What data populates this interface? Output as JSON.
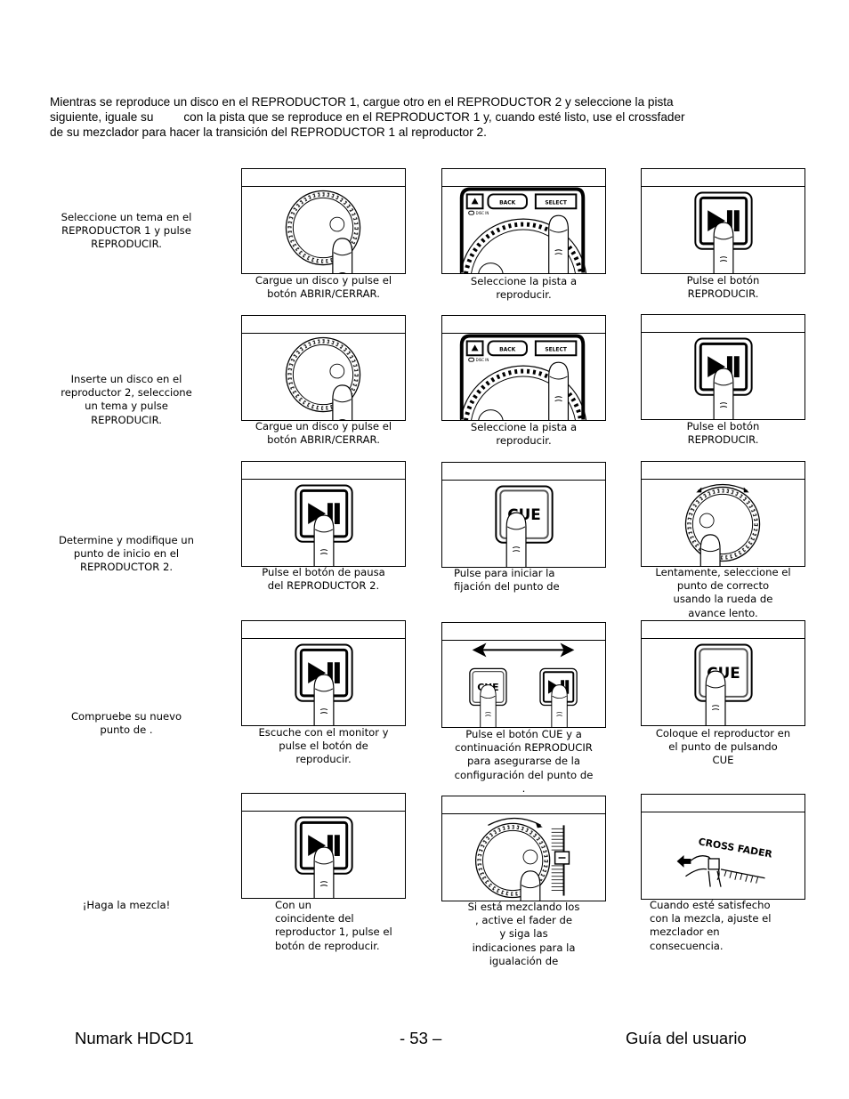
{
  "intro": {
    "line1": "Mientras se reproduce un disco en el REPRODUCTOR 1, cargue otro en el REPRODUCTOR 2 y seleccione la pista",
    "line2": "siguiente, iguale su         con la pista que se reproduce en el REPRODUCTOR 1 y, cuando esté listo, use el crossfader",
    "line3": "de su mezclador para hacer la transición del REPRODUCTOR 1 al reproductor 2."
  },
  "steps": [
    {
      "label": "Seleccione un tema en el\nREPRODUCTOR 1 y pulse\nREPRODUCIR.",
      "panels": [
        {
          "illustration": "jog-wheel-press-icon",
          "caption": "Cargue un disco y pulse el\nbotón ABRIR/CERRAR."
        },
        {
          "illustration": "select-button-panel-icon",
          "caption": "Seleccione la pista a\nreproducir.",
          "buttons": [
            "BACK",
            "SELECT"
          ],
          "led_label": "DISC IN"
        },
        {
          "illustration": "play-pause-button-icon",
          "caption": "Pulse el botón\nREPRODUCIR."
        }
      ]
    },
    {
      "label": "Inserte un disco en el\nreproductor 2, seleccione\nun tema y pulse\nREPRODUCIR.",
      "panels": [
        {
          "illustration": "jog-wheel-press-icon",
          "caption": "Cargue un disco y pulse el\nbotón ABRIR/CERRAR."
        },
        {
          "illustration": "select-button-panel-icon",
          "caption": "Seleccione la pista a\nreproducir.",
          "buttons": [
            "BACK",
            "SELECT"
          ],
          "led_label": "DISC IN"
        },
        {
          "illustration": "play-pause-button-icon",
          "caption": "Pulse el botón\nREPRODUCIR."
        }
      ]
    },
    {
      "label": "Determine y modifique un\npunto       de inicio en el\nREPRODUCTOR 2.",
      "panels": [
        {
          "illustration": "play-pause-button-icon",
          "caption": "Pulse el botón de pausa\ndel REPRODUCTOR 2."
        },
        {
          "illustration": "cue-button-icon",
          "caption": "Pulse        para iniciar la\nfijación del punto de",
          "button_text": "CUE"
        },
        {
          "illustration": "jog-wheel-rotate-icon",
          "caption": "Lentamente, seleccione el\npunto de        correcto\nusando la rueda de\navance lento."
        }
      ]
    },
    {
      "label": "Compruebe su nuevo\npunto de      .",
      "panels": [
        {
          "illustration": "play-pause-button-icon",
          "caption": "Escuche con el monitor y\npulse el botón de\nreproducir."
        },
        {
          "illustration": "cue-and-play-buttons-icon",
          "caption": "Pulse el botón CUE y a\ncontinuación REPRODUCIR\npara asegurarse de la\nconfiguración del punto de\n.",
          "button_text": "CUE"
        },
        {
          "illustration": "cue-button-icon",
          "caption": "Coloque el reproductor en\nel punto de       pulsando\nCUE",
          "button_text": "CUE"
        }
      ]
    },
    {
      "label": "¡Haga la mezcla!",
      "panels": [
        {
          "illustration": "play-pause-button-icon",
          "caption": "Con un\n    coincidente del\nreproductor 1, pulse el\nbotón de reproducir."
        },
        {
          "illustration": "jog-wheel-pitch-fader-icon",
          "caption": "Si está mezclando los\n    , active el fader de\n      y siga las\nindicaciones para la\nigualación de"
        },
        {
          "illustration": "crossfader-hand-icon",
          "caption": "Cuando esté satisfecho\ncon la mezcla, ajuste el\nmezclador en\nconsecuencia.",
          "fader_text": "CROSS FADER"
        }
      ]
    }
  ],
  "footer": {
    "product": "Numark HDCD1",
    "page": "- 53 –",
    "guide": "Guía del usuario"
  }
}
